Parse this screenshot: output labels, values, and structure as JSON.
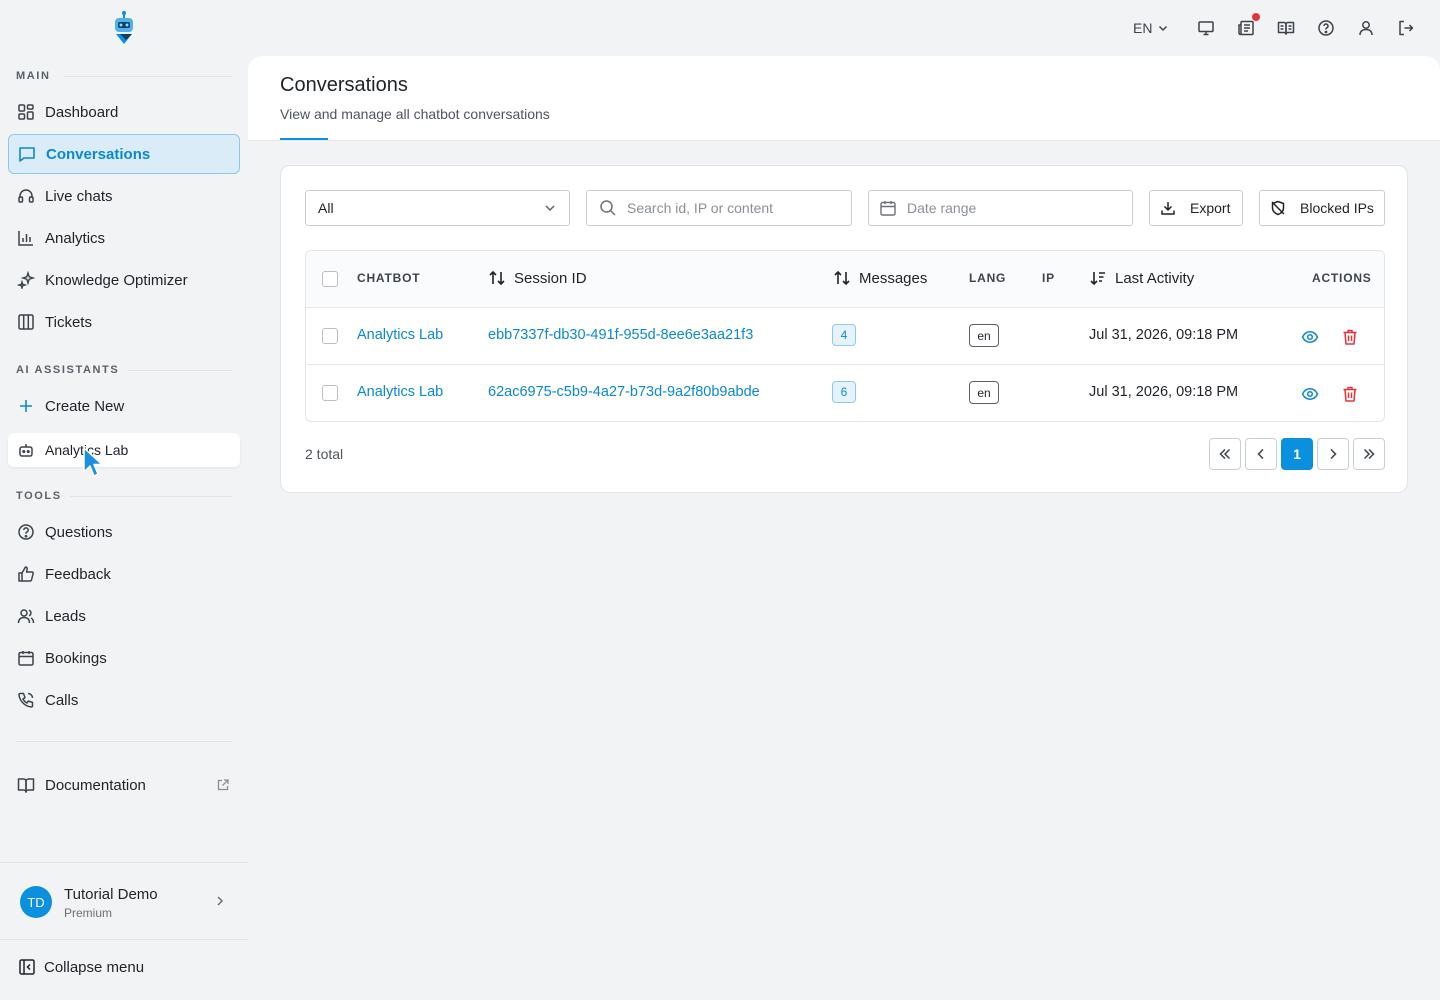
{
  "colors": {
    "accent": "#0b90e0",
    "danger": "#e5333a",
    "link": "#0b88d4"
  },
  "topbar": {
    "language": "EN"
  },
  "sidebar": {
    "sections": {
      "main": "MAIN",
      "ai_assistants": "AI ASSISTANTS",
      "tools": "TOOLS"
    },
    "main_items": [
      {
        "label": "Dashboard",
        "icon": "dashboard-icon"
      },
      {
        "label": "Conversations",
        "icon": "chat-icon"
      },
      {
        "label": "Live chats",
        "icon": "headset-icon"
      },
      {
        "label": "Analytics",
        "icon": "bar-chart-icon"
      },
      {
        "label": "Knowledge Optimizer",
        "icon": "sparkle-icon"
      },
      {
        "label": "Tickets",
        "icon": "columns-icon"
      }
    ],
    "create_new": "Create New",
    "assistant": "Analytics Lab",
    "tool_items": [
      {
        "label": "Questions",
        "icon": "question-icon"
      },
      {
        "label": "Feedback",
        "icon": "thumbs-up-icon"
      },
      {
        "label": "Leads",
        "icon": "users-icon"
      },
      {
        "label": "Bookings",
        "icon": "calendar-icon"
      },
      {
        "label": "Calls",
        "icon": "phone-icon"
      }
    ],
    "documentation": "Documentation",
    "user": {
      "initials": "TD",
      "name": "Tutorial Demo",
      "plan": "Premium"
    },
    "collapse": "Collapse menu"
  },
  "page": {
    "title": "Conversations",
    "subtitle": "View and manage all chatbot conversations"
  },
  "filters": {
    "chatbot_select": "All",
    "search_placeholder": "Search id, IP or content",
    "date_placeholder": "Date range",
    "export_label": "Export",
    "blocked_label": "Blocked IPs"
  },
  "table": {
    "headers": {
      "chatbot": "CHATBOT",
      "session_id": "Session ID",
      "messages": "Messages",
      "lang": "LANG",
      "ip": "IP",
      "last_activity": "Last Activity",
      "actions": "ACTIONS"
    },
    "rows": [
      {
        "chatbot": "Analytics Lab",
        "session_id": "ebb7337f-db30-491f-955d-8ee6e3aa21f3",
        "messages": "4",
        "lang": "en",
        "ip": "",
        "last_activity": "Jul 31, 2026, 09:18 PM"
      },
      {
        "chatbot": "Analytics Lab",
        "session_id": "62ac6975-c5b9-4a27-b73d-9a2f80b9abde",
        "messages": "6",
        "lang": "en",
        "ip": "",
        "last_activity": "Jul 31, 2026, 09:18 PM"
      }
    ]
  },
  "pagination": {
    "total": "2 total",
    "current_page": "1"
  }
}
